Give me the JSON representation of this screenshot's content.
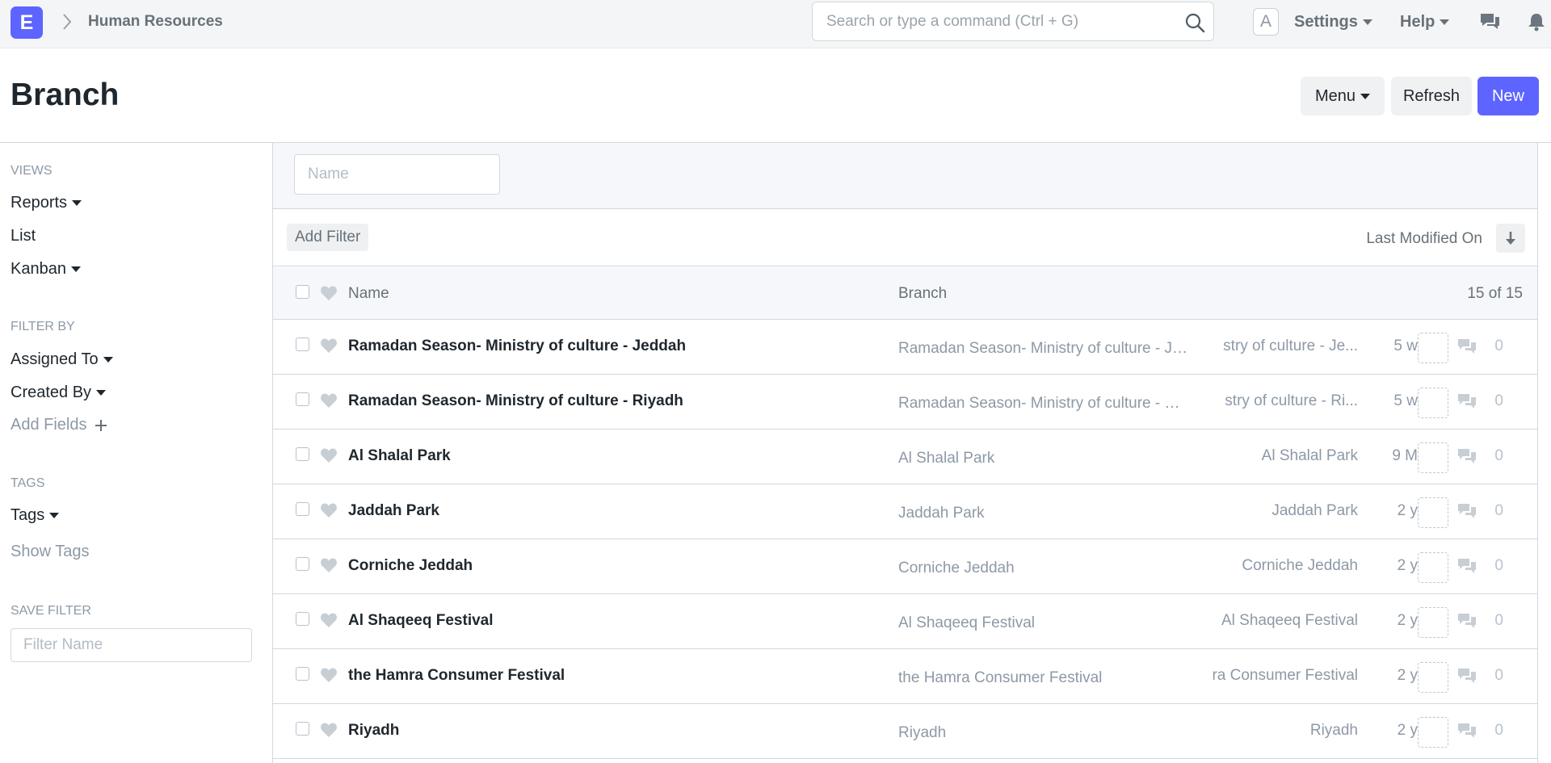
{
  "navbar": {
    "logo_letter": "E",
    "breadcrumb": "Human Resources",
    "search_placeholder": "Search or type a command (Ctrl + G)",
    "avatar_letter": "A",
    "settings_label": "Settings",
    "help_label": "Help",
    "icons": [
      "chevron-right-icon",
      "search-icon",
      "chat-icon",
      "bell-icon"
    ]
  },
  "page": {
    "title": "Branch",
    "menu_label": "Menu",
    "refresh_label": "Refresh",
    "new_label": "New"
  },
  "sidebar": {
    "views_label": "VIEWS",
    "reports": "Reports",
    "list": "List",
    "kanban": "Kanban",
    "filter_by_label": "FILTER BY",
    "assigned_to": "Assigned To",
    "created_by": "Created By",
    "add_fields": "Add Fields",
    "tags_label": "TAGS",
    "tags": "Tags",
    "show_tags": "Show Tags",
    "save_filter_label": "SAVE FILTER",
    "filter_name_placeholder": "Filter Name"
  },
  "filters": {
    "name_placeholder": "Name",
    "add_filter": "Add Filter",
    "sort_label": "Last Modified On"
  },
  "list": {
    "col_name": "Name",
    "col_branch": "Branch",
    "count": "15 of 15",
    "rows": [
      {
        "name": "Ramadan Season- Ministry of culture - Jeddah",
        "branch": "Ramadan Season- Ministry of culture - Jeddah",
        "branch2": "stry of culture - Je...",
        "time": "5 w",
        "comments": "0"
      },
      {
        "name": "Ramadan Season- Ministry of culture - Riyadh",
        "branch": "Ramadan Season- Ministry of culture - Riyadh",
        "branch2": "stry of culture - Ri...",
        "time": "5 w",
        "comments": "0"
      },
      {
        "name": "Al Shalal Park",
        "branch": "Al Shalal Park",
        "branch2": "Al Shalal Park",
        "time": "9 M",
        "comments": "0"
      },
      {
        "name": "Jaddah Park",
        "branch": "Jaddah Park",
        "branch2": "Jaddah Park",
        "time": "2 y",
        "comments": "0"
      },
      {
        "name": "Corniche Jeddah",
        "branch": "Corniche Jeddah",
        "branch2": "Corniche Jeddah",
        "time": "2 y",
        "comments": "0"
      },
      {
        "name": "Al Shaqeeq Festival",
        "branch": "Al Shaqeeq Festival",
        "branch2": "Al Shaqeeq Festival",
        "time": "2 y",
        "comments": "0"
      },
      {
        "name": "the Hamra Consumer Festival",
        "branch": "the Hamra Consumer Festival",
        "branch2": "ra Consumer Festival",
        "time": "2 y",
        "comments": "0"
      },
      {
        "name": "Riyadh",
        "branch": "Riyadh",
        "branch2": "Riyadh",
        "time": "2 y",
        "comments": "0"
      }
    ]
  },
  "colors": {
    "accent": "#5e64ff",
    "muted_text": "#8d99a6",
    "border": "#d1d8dd"
  }
}
